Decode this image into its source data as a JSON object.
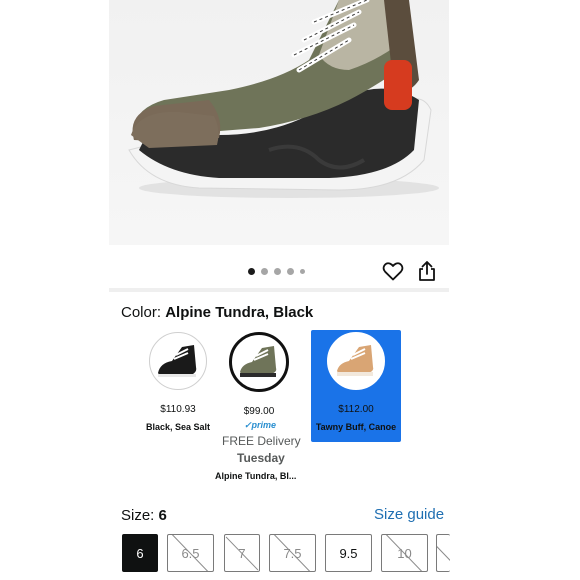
{
  "product": {
    "image_alt": "shoe-main-image",
    "pager": {
      "count": 5,
      "active_index": 0
    }
  },
  "actions": {
    "wishlist_icon": "heart-icon",
    "share_icon": "share-icon"
  },
  "color": {
    "label": "Color: ",
    "selected": "Alpine Tundra, Black",
    "swatches": [
      {
        "price": "$110.93",
        "name": "Black, Sea Salt",
        "selected": false,
        "highlighted": false
      },
      {
        "price": "$99.00",
        "name": "Alpine Tundra, Bl...",
        "selected": true,
        "highlighted": false,
        "prime": "✓prime",
        "delivery": "FREE Delivery",
        "delivery_day": "Tuesday"
      },
      {
        "price": "$112.00",
        "name": "Tawny Buff, Canoe",
        "selected": false,
        "highlighted": true
      }
    ]
  },
  "size": {
    "label": "Size: ",
    "selected": "6",
    "guide_label": "Size guide",
    "options": [
      {
        "label": "6",
        "available": true,
        "selected": true
      },
      {
        "label": "6.5",
        "available": false,
        "selected": false
      },
      {
        "label": "7",
        "available": false,
        "selected": false
      },
      {
        "label": "7.5",
        "available": false,
        "selected": false
      },
      {
        "label": "9.5",
        "available": true,
        "selected": false
      },
      {
        "label": "10",
        "available": false,
        "selected": false
      }
    ]
  },
  "colors": {
    "accent": "#1a73e8",
    "link": "#1f6fb2",
    "prime": "#2a8fd0"
  }
}
